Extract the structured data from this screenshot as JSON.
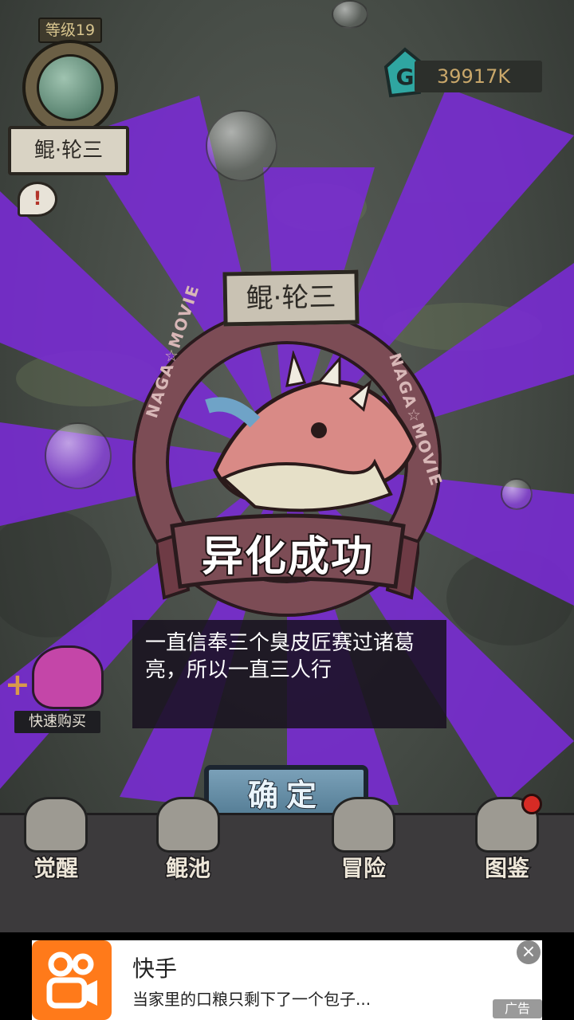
{
  "player": {
    "level_label": "等级19",
    "name": "鲲·轮三"
  },
  "currency": {
    "amount": "39917K",
    "icon": "g-gem-icon"
  },
  "modal": {
    "fish_name": "鲲·轮三",
    "ring_text_left": "NAGA☆MOVIE",
    "ring_text_right": "NAGA☆MOVIE",
    "banner": "异化成功",
    "description": "一直信奉三个臭皮匠赛过诸葛亮，所以一直三人行",
    "confirm_label": "确定"
  },
  "quick_buy": {
    "label": "快速购买"
  },
  "nav": {
    "items": [
      {
        "label": "觉醒"
      },
      {
        "label": "鲲池"
      },
      {
        "label": "冒险"
      },
      {
        "label": "图鉴"
      }
    ]
  },
  "ad": {
    "app_name": "快手",
    "text": "当家里的口粮只剩下了一个包子...",
    "tag": "广告",
    "close": "×"
  },
  "colors": {
    "ray": "#7a2bd6",
    "ring": "#7c4c55",
    "button": "#5f88a0",
    "ad_logo": "#ff7a1a"
  }
}
